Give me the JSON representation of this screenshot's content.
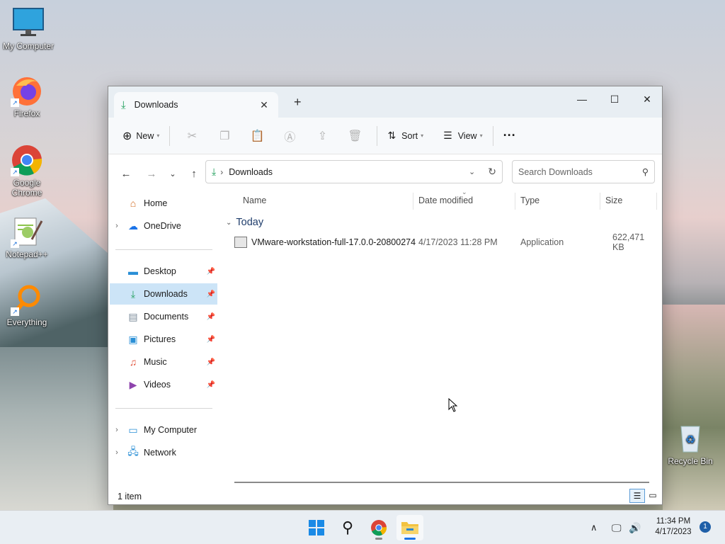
{
  "desktop": {
    "icons": [
      {
        "label": "My Computer"
      },
      {
        "label": "Firefox"
      },
      {
        "label": "Google Chrome"
      },
      {
        "label": "Notepad++"
      },
      {
        "label": "Everything"
      },
      {
        "label": "Recycle Bin"
      }
    ]
  },
  "window": {
    "tab_title": "Downloads",
    "new_tab": "+",
    "controls": {
      "minimize": "—",
      "maximize": "☐",
      "close": "✕"
    }
  },
  "toolbar": {
    "new_label": "New",
    "sort_label": "Sort",
    "view_label": "View",
    "more_label": "···"
  },
  "address": {
    "crumb": "Downloads",
    "search_placeholder": "Search Downloads"
  },
  "sidebar": {
    "home": "Home",
    "onedrive": "OneDrive",
    "pinned": [
      "Desktop",
      "Downloads",
      "Documents",
      "Pictures",
      "Music",
      "Videos"
    ],
    "my_computer": "My Computer",
    "network": "Network"
  },
  "columns": {
    "name": "Name",
    "date": "Date modified",
    "type": "Type",
    "size": "Size"
  },
  "groups": [
    {
      "title": "Today",
      "files": [
        {
          "name": "VMware-workstation-full-17.0.0-20800274",
          "date": "4/17/2023 11:28 PM",
          "type": "Application",
          "size": "622,471 KB"
        }
      ]
    }
  ],
  "status": {
    "count": "1 item"
  },
  "taskbar": {
    "clock_time": "11:34 PM",
    "clock_date": "4/17/2023",
    "notification_count": "1"
  }
}
